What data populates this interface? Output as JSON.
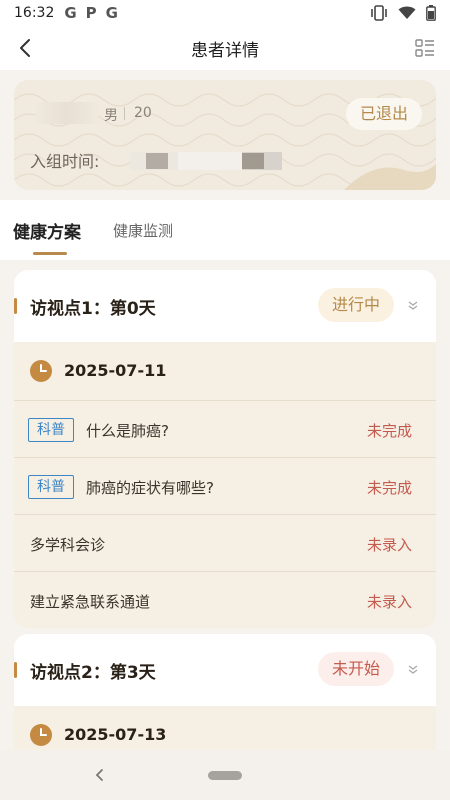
{
  "status_bar": {
    "time": "16:32",
    "icons": [
      "google-icon",
      "pinterest-icon",
      "google-icon",
      "vibrate-icon",
      "wifi-icon",
      "battery-icon"
    ],
    "g1": "G",
    "p": "P",
    "g2": "G"
  },
  "navbar": {
    "title": "患者详情",
    "back_icon": "back-arrow-icon",
    "menu_icon": "list-menu-icon"
  },
  "patient": {
    "gender": "男",
    "age": "20",
    "status": "已退出",
    "join_label": "入组时间:"
  },
  "tabs": [
    {
      "label": "健康方案",
      "active": true
    },
    {
      "label": "健康监测",
      "active": false
    }
  ],
  "visits": [
    {
      "title": "访视点1：第0天",
      "status": "进行中",
      "date": "2025-07-11",
      "tasks": [
        {
          "tag": "科普",
          "label": "什么是肺癌?",
          "status": "未完成"
        },
        {
          "tag": "科普",
          "label": "肺癌的症状有哪些?",
          "status": "未完成"
        },
        {
          "tag": "",
          "label": "多学科会诊",
          "status": "未录入"
        },
        {
          "tag": "",
          "label": "建立紧急联系通道",
          "status": "未录入"
        }
      ]
    },
    {
      "title": "访视点2：第3天",
      "status": "未开始",
      "date": "2025-07-13",
      "tasks": []
    }
  ],
  "colors": {
    "accent": "#b8894d",
    "tag_blue": "#3f86c6",
    "status_red": "#c55a4e",
    "card_bg": "#f1ebdf",
    "section_bg": "#f5efe4"
  }
}
